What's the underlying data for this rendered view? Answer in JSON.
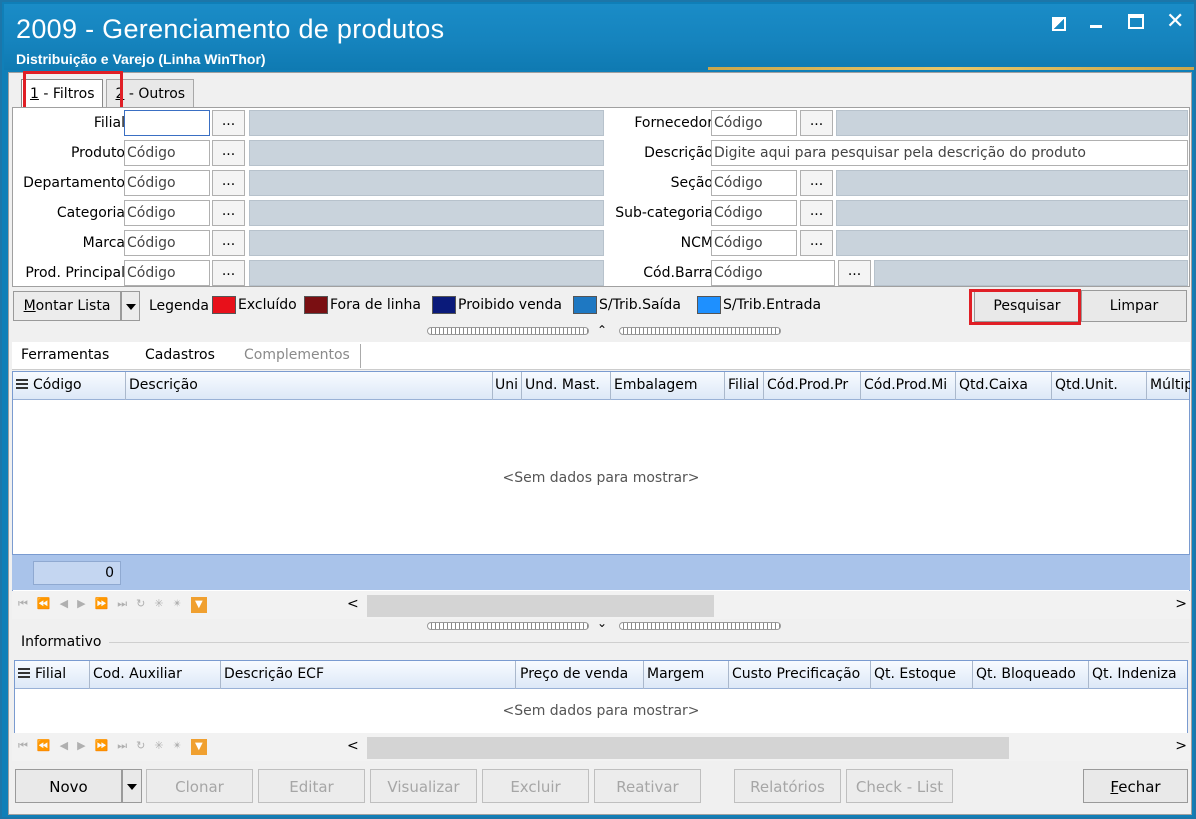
{
  "window": {
    "title": "2009 - Gerenciamento de produtos",
    "subtitle": "Distribuição e Varejo (Linha WinThor)"
  },
  "tabs": [
    {
      "label_u": "1",
      "label_rest": " - Filtros",
      "active": true
    },
    {
      "label_u": "2",
      "label_rest": " - Outros",
      "active": false
    }
  ],
  "filters_left": [
    {
      "label": "Filial",
      "value": "",
      "button": "..."
    },
    {
      "label": "Produto",
      "value": "Código",
      "button": "..."
    },
    {
      "label": "Departamento",
      "value": "Código",
      "button": "..."
    },
    {
      "label": "Categoria",
      "value": "Código",
      "button": "..."
    },
    {
      "label": "Marca",
      "value": "Código",
      "button": "..."
    },
    {
      "label": "Prod. Principal",
      "value": "Código",
      "button": "..."
    }
  ],
  "filters_right": [
    {
      "label": "Fornecedor",
      "value": "Código",
      "button": "..."
    },
    {
      "label": "Descrição",
      "value": "Digite aqui para pesquisar pela descrição do produto"
    },
    {
      "label": "Seção",
      "value": "Código",
      "button": "..."
    },
    {
      "label": "Sub-categoria",
      "value": "Código",
      "button": "..."
    },
    {
      "label": "NCM",
      "value": "Código",
      "button": "..."
    },
    {
      "label": "Cód.Barra",
      "value": "Código",
      "button": "..."
    }
  ],
  "legend": {
    "montar_u": "M",
    "montar_rest": "ontar Lista",
    "label": "Legenda",
    "items": [
      {
        "label": "Excluído",
        "color": "#e8101a"
      },
      {
        "label": "Fora de linha",
        "color": "#7a0f12"
      },
      {
        "label": "Proibido venda",
        "color": "#0a1a7a"
      },
      {
        "label": "S/Trib.Saída",
        "color": "#1e78c2"
      },
      {
        "label": "S/Trib.Entrada",
        "color": "#1e90ff"
      }
    ],
    "search": "Pesquisar",
    "clear": "Limpar"
  },
  "menu": {
    "tools": "Ferramentas",
    "registers": "Cadastros",
    "complements": "Complementos"
  },
  "grid1": {
    "columns": [
      "Código",
      "Descrição",
      "Uni",
      "Und. Mast.",
      "Embalagem",
      "Filial",
      "Cód.Prod.Pr",
      "Cód.Prod.Mi",
      "Qtd.Caixa",
      "Qtd.Unit.",
      "Múltip"
    ],
    "empty": "<Sem dados para mostrar>",
    "count": "0"
  },
  "info": {
    "label": "Informativo"
  },
  "grid2": {
    "columns": [
      "Filial",
      "Cod. Auxiliar",
      "Descrição ECF",
      "Preço de venda",
      "Margem",
      "Custo Precificação",
      "Qt. Estoque",
      "Qt. Bloqueado",
      "Qt. Indeniza"
    ],
    "empty": "<Sem dados para mostrar>"
  },
  "bottom": {
    "new": "Novo",
    "clone": "Clonar",
    "edit": "Editar",
    "view": "Visualizar",
    "delete": "Excluir",
    "reactivate": "Reativar",
    "reports": "Relatórios",
    "checklist": "Check - List",
    "close_u": "F",
    "close_rest": "echar"
  },
  "nav": {
    "left_arrow": "<",
    "right_arrow": ">"
  }
}
